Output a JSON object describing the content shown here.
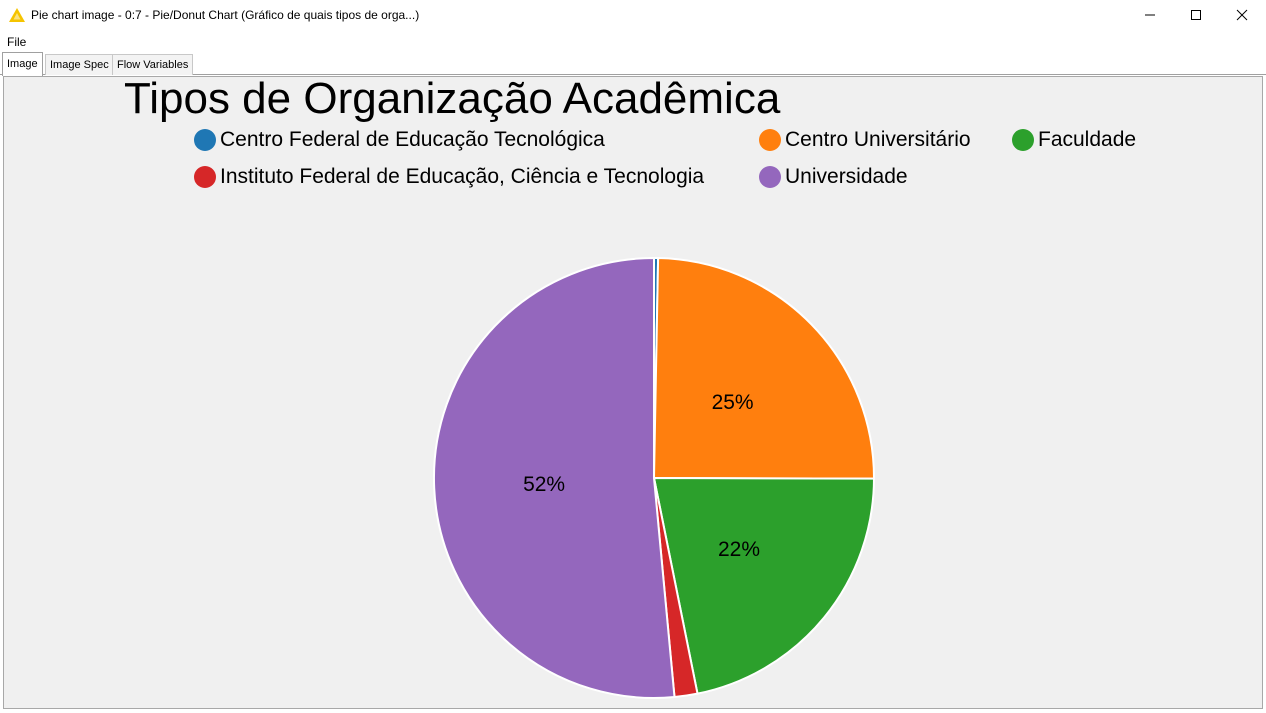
{
  "window": {
    "title": "Pie chart image - 0:7 - Pie/Donut Chart (Gráfico de quais tipos de orga...)",
    "icon": "knime-warning-triangle-icon"
  },
  "menu": {
    "file_label": "File"
  },
  "tabs": [
    {
      "label": "Image",
      "active": true
    },
    {
      "label": "Image Spec",
      "active": false
    },
    {
      "label": "Flow Variables",
      "active": false
    }
  ],
  "chart_data": {
    "type": "pie",
    "title": "Tipos de Organização Acadêmica",
    "legend_position": "top",
    "categories": [
      "Centro Federal de Educação Tecnológica",
      "Centro Universitário",
      "Faculdade",
      "Instituto Federal de Educação, Ciência e Tecnologia",
      "Universidade"
    ],
    "values": [
      0.3,
      25,
      22,
      1.7,
      52
    ],
    "colors": [
      "#1f77b4",
      "#ff7f0e",
      "#2ca02c",
      "#d62728",
      "#9467bd"
    ],
    "data_labels": [
      "",
      "25%",
      "22%",
      "",
      "52%"
    ]
  }
}
